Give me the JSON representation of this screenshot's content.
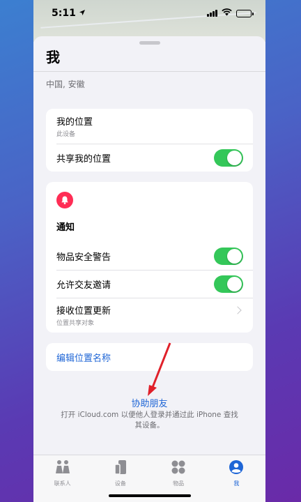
{
  "status_bar": {
    "time": "5:11",
    "location_arrow": "location-arrow-icon"
  },
  "sheet": {
    "title": "我",
    "location": "中国, 安徽"
  },
  "my_location_card": {
    "my_location_label": "我的位置",
    "my_location_sub": "此设备",
    "share_label": "共享我的位置",
    "share_on": true
  },
  "notifications_card": {
    "icon": "bell-icon",
    "title": "通知",
    "item_safety_label": "物品安全警告",
    "item_safety_on": true,
    "friend_invite_label": "允许交友邀请",
    "friend_invite_on": true,
    "receive_updates_label": "接收位置更新",
    "receive_updates_sub": "位置共享对象"
  },
  "edit_location_name": "编辑位置名称",
  "help_friend": {
    "link": "协助朋友",
    "description": "打开 iCloud.com 以便他人登录并通过此 iPhone 查找其设备。"
  },
  "tabs": [
    {
      "label": "联系人",
      "icon": "people-icon"
    },
    {
      "label": "设备",
      "icon": "devices-icon"
    },
    {
      "label": "物品",
      "icon": "items-icon"
    },
    {
      "label": "我",
      "icon": "me-icon",
      "active": true
    }
  ],
  "colors": {
    "accent": "#1f66d6",
    "toggle_on": "#34c759",
    "bell": "#ff2d55",
    "annotation_arrow": "#e0202a"
  }
}
